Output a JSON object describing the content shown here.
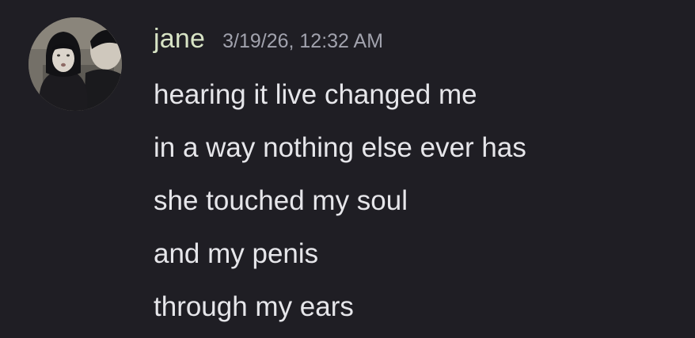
{
  "message": {
    "author": "jane",
    "timestamp": "3/19/26, 12:32 AM",
    "avatar_icon": "user-photo-avatar",
    "lines": [
      "hearing it live changed me",
      "in a way nothing else ever has",
      "she touched my soul",
      "and my penis",
      "through my ears"
    ]
  },
  "colors": {
    "background": "#1f1e24",
    "username": "#d7e3c5",
    "timestamp": "#a1a2ad",
    "text": "#e6e6ea"
  }
}
